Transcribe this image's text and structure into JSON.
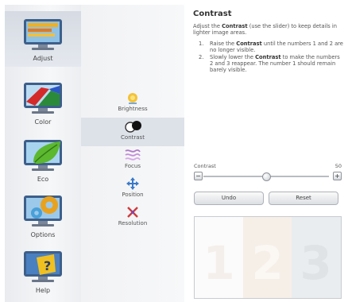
{
  "categories": [
    {
      "label": "Adjust",
      "active": true
    },
    {
      "label": "Color",
      "active": false
    },
    {
      "label": "Eco",
      "active": false
    },
    {
      "label": "Options",
      "active": false
    },
    {
      "label": "Help",
      "active": false
    }
  ],
  "subitems": [
    {
      "label": "Brightness",
      "active": false
    },
    {
      "label": "Contrast",
      "active": true
    },
    {
      "label": "Focus",
      "active": false
    },
    {
      "label": "Position",
      "active": false
    },
    {
      "label": "Resolution",
      "active": false
    }
  ],
  "panel": {
    "title": "Contrast",
    "desc_pre": "Adjust the ",
    "desc_bold": "Contrast",
    "desc_post": " (use the slider) to keep details in lighter image areas.",
    "step1_num": "1.",
    "step1_pre": "Raise the ",
    "step1_bold": "Contrast",
    "step1_post": " until the numbers 1 and 2 are no longer visible.",
    "step2_num": "2.",
    "step2_pre": "Slowly lower the ",
    "step2_bold": "Contrast",
    "step2_post": " to make the numbers 2 and 3 reappear. The number 1 should remain barely visible."
  },
  "slider": {
    "label": "Contrast",
    "value": "50",
    "level": 0.5,
    "minus": "−",
    "plus": "+"
  },
  "buttons": {
    "undo": "Undo",
    "reset": "Reset"
  },
  "preview": {
    "n1": "1",
    "n2": "2",
    "n3": "3"
  },
  "colors": {
    "accent": "#e05a2a",
    "selected": "#dde2e9"
  }
}
